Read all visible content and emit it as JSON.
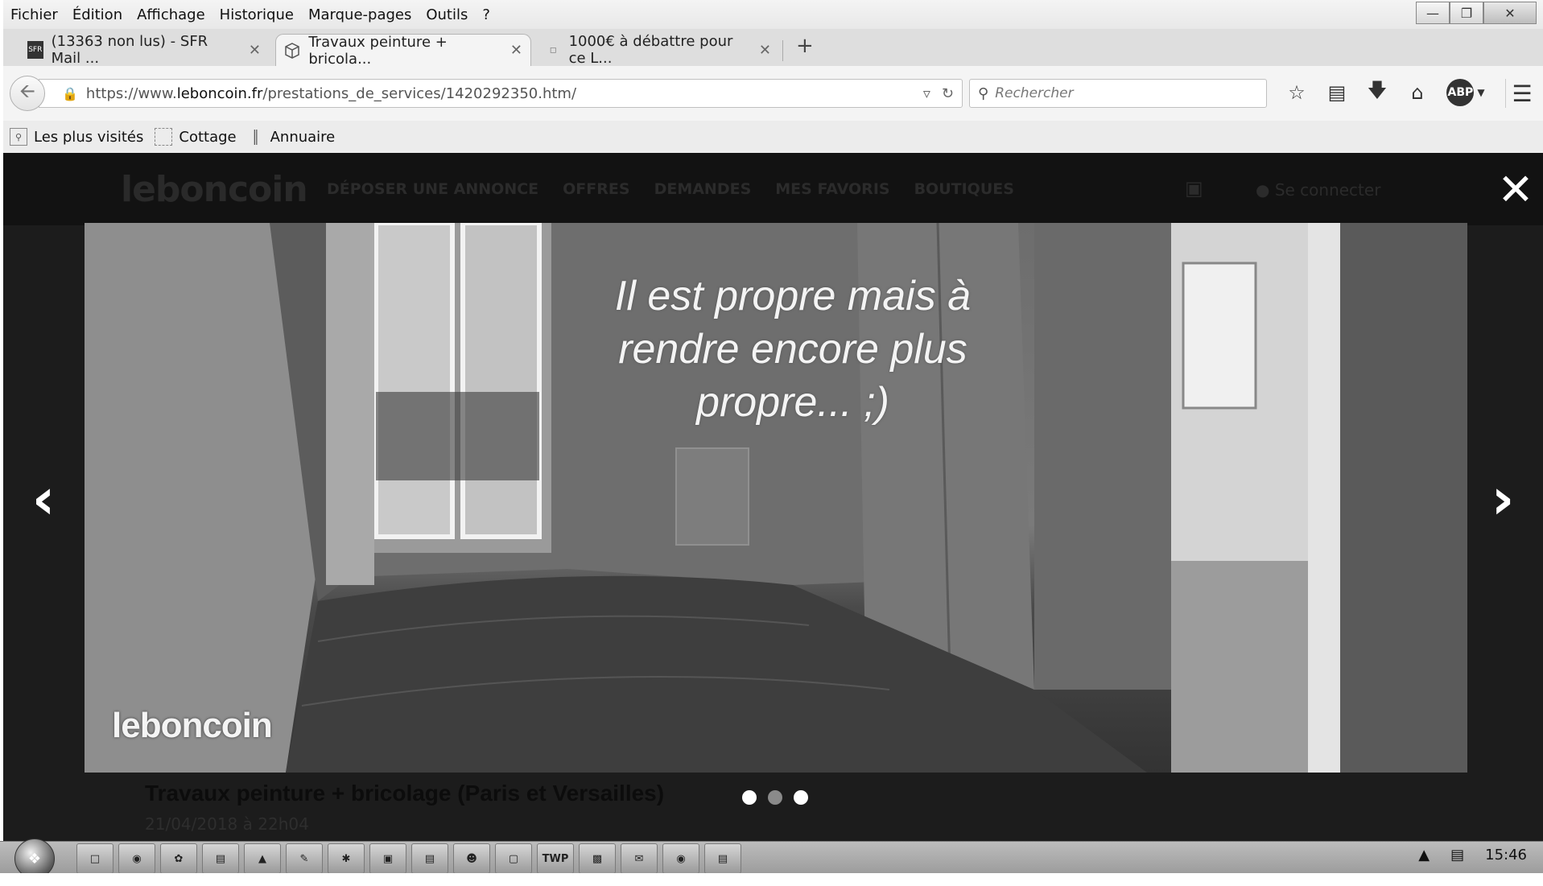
{
  "menubar": {
    "items": [
      "Fichier",
      "Édition",
      "Affichage",
      "Historique",
      "Marque-pages",
      "Outils",
      "?"
    ],
    "window_controls": [
      "minimize-icon",
      "maximize-icon",
      "close-icon"
    ]
  },
  "tabs": [
    {
      "favicon": "SFR",
      "label": "(13363 non lus) - SFR Mail ...",
      "active": false
    },
    {
      "favicon": "cube-icon",
      "label": "Travaux peinture + bricola...",
      "active": true
    },
    {
      "favicon": "page-icon",
      "label": "1000€ à débattre pour ce L...",
      "active": false
    }
  ],
  "navbar": {
    "url_prefix": "https://www.",
    "url_domain": "leboncoin.fr",
    "url_path": "/prestations_de_services/1420292350.htm/",
    "search_placeholder": "Rechercher",
    "abp_label": "ABP"
  },
  "bookmarks": [
    {
      "icon": "most-visited-icon",
      "label": "Les plus visités"
    },
    {
      "icon": "folder-icon",
      "label": "Cottage"
    },
    {
      "icon": "bars-icon",
      "label": "Annuaire"
    }
  ],
  "site": {
    "logo": "leboncoin",
    "nav": [
      "DÉPOSER UNE ANNONCE",
      "OFFRES",
      "DEMANDES",
      "MES FAVORIS",
      "BOUTIQUES"
    ],
    "login": "Se connecter"
  },
  "lightbox": {
    "caption": "Il est propre mais à rendre encore plus propre... ;)",
    "watermark": "leboncoin",
    "title": "Travaux peinture + bricolage (Paris et Versailles)",
    "date": "21/04/2018 à 22h04",
    "slides": [
      {
        "active": true
      },
      {
        "active": false
      },
      {
        "active": true
      }
    ]
  },
  "taskbar": {
    "apps": [
      "",
      "",
      "",
      "",
      "",
      "",
      "",
      "",
      "",
      "",
      "",
      "TWP",
      "",
      "",
      "",
      ""
    ],
    "time": "15:46"
  }
}
